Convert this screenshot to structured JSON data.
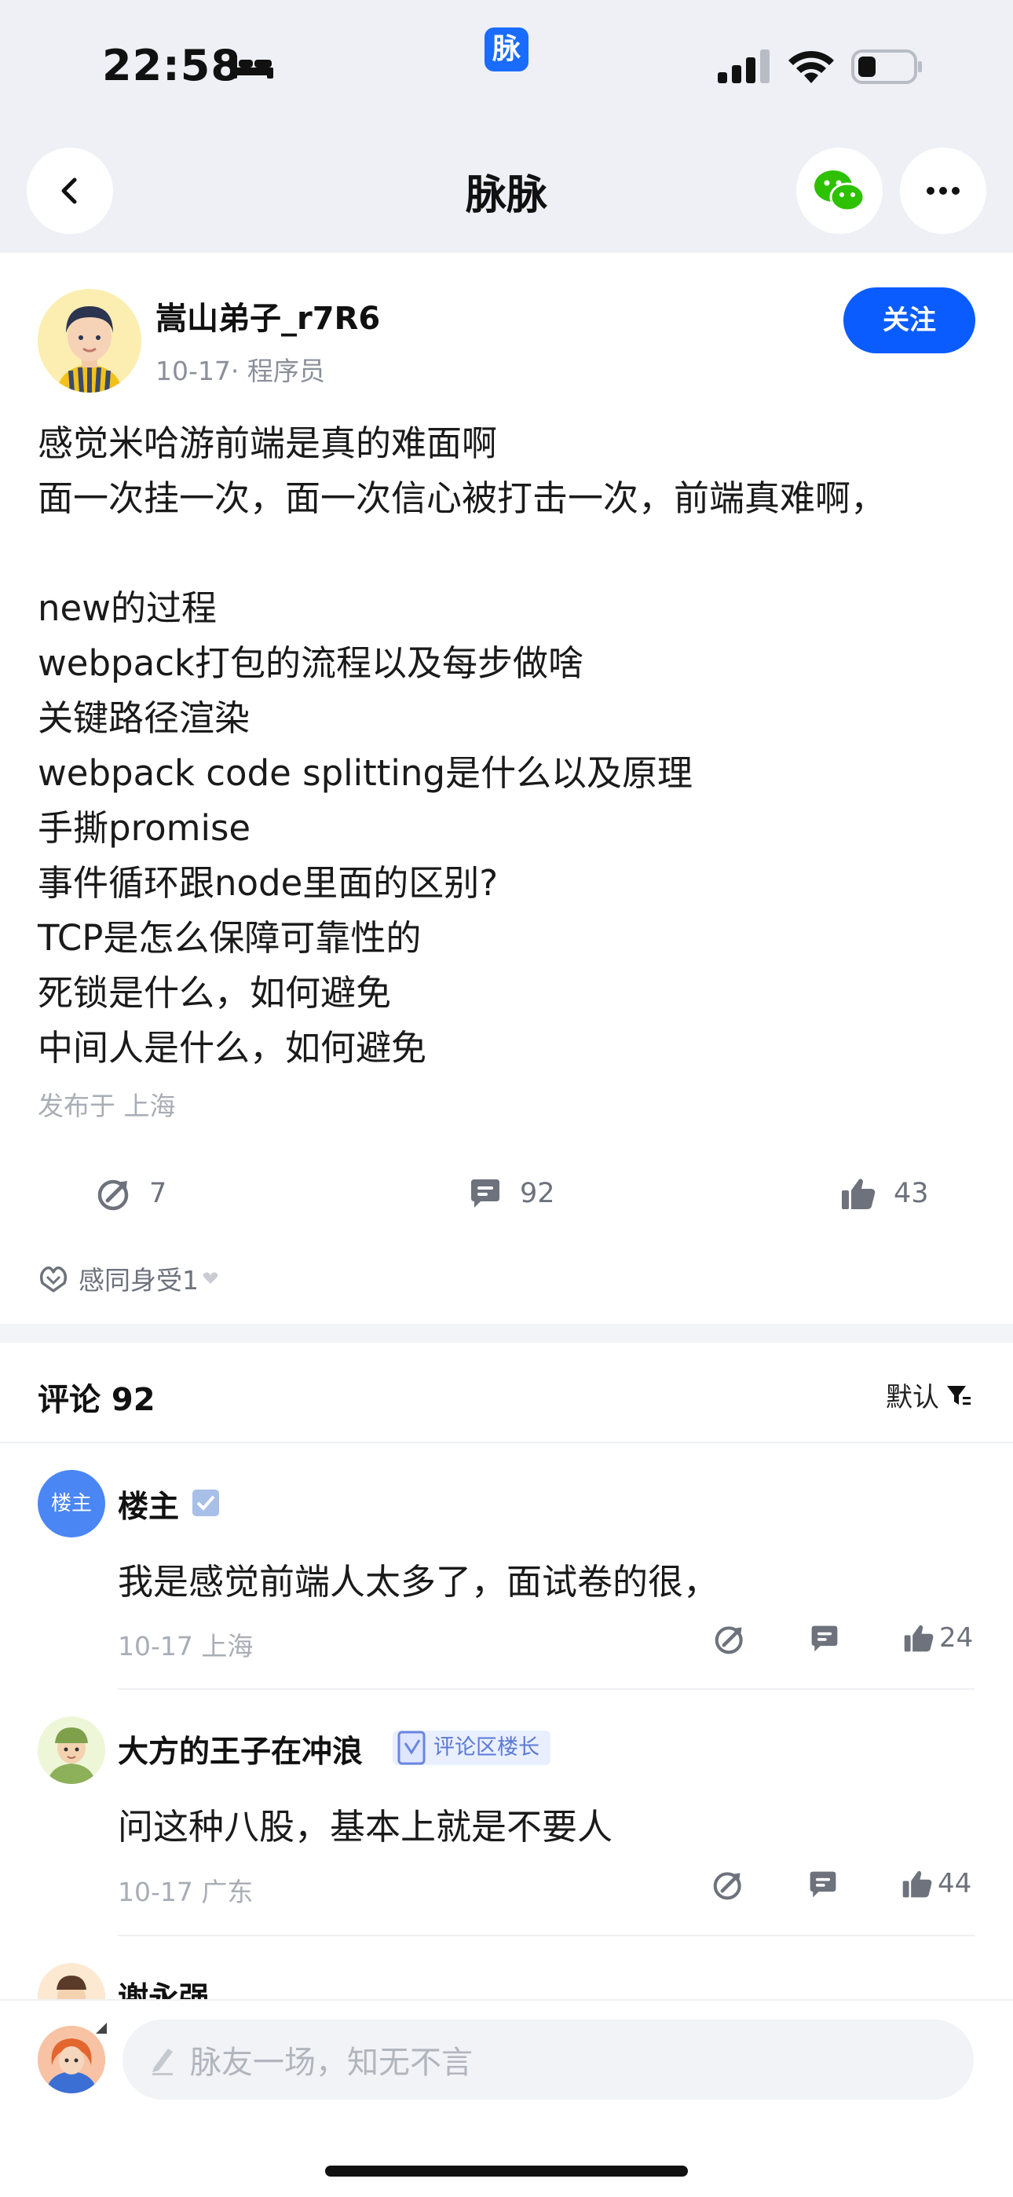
{
  "status_bar": {
    "time": "22:58",
    "app_badge": "脉"
  },
  "nav": {
    "title": "脉脉"
  },
  "post": {
    "author": "嵩山弟子_r7R6",
    "meta": "10-17· 程序员",
    "follow_label": "关注",
    "lines": [
      "感觉米哈游前端是真的难面啊",
      "面一次挂一次，面一次信心被打击一次，前端真难啊，",
      "",
      "new的过程",
      "webpack打包的流程以及每步做啥",
      "关键路径渲染",
      "webpack code splitting是什么以及原理",
      "手撕promise",
      "事件循环跟node里面的区别?",
      "TCP是怎么保障可靠性的",
      "死锁是什么，如何避免",
      "中间人是什么，如何避免"
    ],
    "location": "发布于 上海",
    "stats": {
      "shares": "7",
      "comments": "92",
      "likes": "43"
    },
    "empathy": "感同身受1"
  },
  "comments_section": {
    "title": "评论 92",
    "sort_label": "默认",
    "comments": [
      {
        "avatar_text": "楼主",
        "name": "楼主",
        "text": "我是感觉前端人太多了，面试卷的很，",
        "meta": "10-17  上海",
        "likes": "24"
      },
      {
        "name": "大方的王子在冲浪",
        "tag": "评论区楼长",
        "text": "问这种八股，基本上就是不要人",
        "meta": "10-17  广东",
        "likes": "44"
      },
      {
        "name": "谢永强"
      }
    ]
  },
  "composer": {
    "placeholder": "脉友一场，知无不言"
  },
  "colors": {
    "accent": "#0a5cff",
    "app_blue": "#1a6cff"
  }
}
